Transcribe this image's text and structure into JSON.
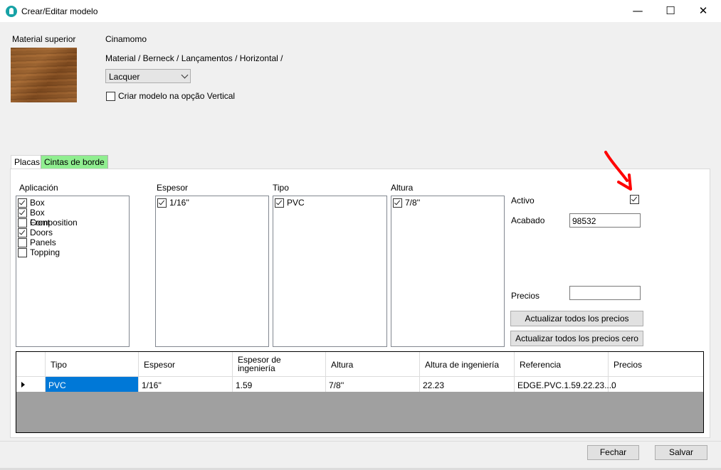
{
  "window": {
    "title": "Crear/Editar modelo"
  },
  "material": {
    "label": "Material superior",
    "name": "Cinamomo",
    "path": "Material / Berneck / Lançamentos / Horizontal /",
    "finish_select": "Lacquer",
    "vertical_checkbox_label": "Criar modelo na opção  Vertical",
    "vertical_checked": false
  },
  "tabs": [
    {
      "label": "Placas",
      "active": false
    },
    {
      "label": "Cintas de borde",
      "active": true,
      "color": "#90ee90"
    }
  ],
  "filters": {
    "aplicacion": {
      "label": "Aplicación",
      "items": [
        {
          "label": "Box",
          "checked": true
        },
        {
          "label": "Box Front",
          "checked": true
        },
        {
          "label": "Composition",
          "checked": false
        },
        {
          "label": "Doors",
          "checked": true
        },
        {
          "label": "Panels",
          "checked": false
        },
        {
          "label": "Topping",
          "checked": false
        }
      ]
    },
    "espesor": {
      "label": "Espesor",
      "items": [
        {
          "label": "1/16''",
          "checked": true
        }
      ]
    },
    "tipo": {
      "label": "Tipo",
      "items": [
        {
          "label": "PVC",
          "checked": true
        }
      ]
    },
    "altura": {
      "label": "Altura",
      "items": [
        {
          "label": "7/8''",
          "checked": true
        }
      ]
    }
  },
  "props": {
    "activo_label": "Activo",
    "activo_checked": true,
    "acabado_label": "Acabado",
    "acabado_value": "98532",
    "precios_label": "Precios",
    "precios_value": "",
    "update_prices_button": "Actualizar todos los precios",
    "update_prices_zero_button": "Actualizar todos los precios cero"
  },
  "grid": {
    "columns": [
      "Tipo",
      "Espesor",
      "Espesor de ingeniería",
      "Altura",
      "Altura de ingeniería",
      "Referencia",
      "Precios"
    ],
    "rows": [
      [
        "PVC",
        "1/16''",
        "1.59",
        "7/8''",
        "22.23",
        "EDGE.PVC.1.59.22.23....",
        "0"
      ]
    ]
  },
  "buttons": {
    "close": "Fechar",
    "save": "Salvar"
  },
  "colors": {
    "annotation_arrow": "#ff0000",
    "selection": "#0078d7",
    "tab_highlight": "#90ee90"
  }
}
